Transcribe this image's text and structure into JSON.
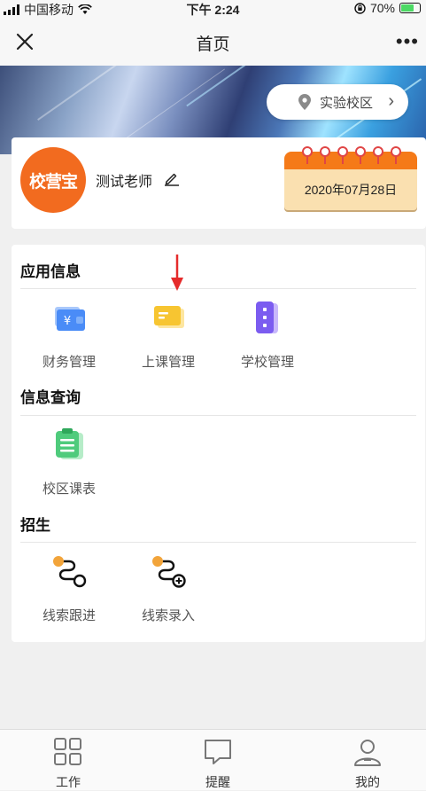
{
  "status_bar": {
    "carrier": "中国移动",
    "time": "下午 2:24",
    "battery": "70%"
  },
  "nav": {
    "title": "首页"
  },
  "campus": {
    "label": "实验校区"
  },
  "profile": {
    "logo_text": "校营宝",
    "name": "测试老师",
    "date": "2020年07月28日"
  },
  "sections": [
    {
      "title": "应用信息",
      "items": [
        {
          "label": "财务管理",
          "icon": "wallet-icon"
        },
        {
          "label": "上课管理",
          "icon": "card-icon"
        },
        {
          "label": "学校管理",
          "icon": "building-icon"
        }
      ]
    },
    {
      "title": "信息查询",
      "items": [
        {
          "label": "校区课表",
          "icon": "clipboard-icon"
        }
      ]
    },
    {
      "title": "招生",
      "items": [
        {
          "label": "线索跟进",
          "icon": "route-icon"
        },
        {
          "label": "线索录入",
          "icon": "route-add-icon"
        }
      ]
    }
  ],
  "tabs": [
    {
      "label": "工作",
      "icon": "grid-icon"
    },
    {
      "label": "提醒",
      "icon": "chat-bubble-icon"
    },
    {
      "label": "我的",
      "icon": "user-icon"
    }
  ],
  "colors": {
    "brand_orange": "#f26b1f",
    "annotation_red": "#e52b2b",
    "wallet_blue": "#4a8cf7",
    "card_yellow": "#f7c531",
    "building_purple": "#7b5cf0",
    "clipboard_green": "#4fcb7c"
  }
}
